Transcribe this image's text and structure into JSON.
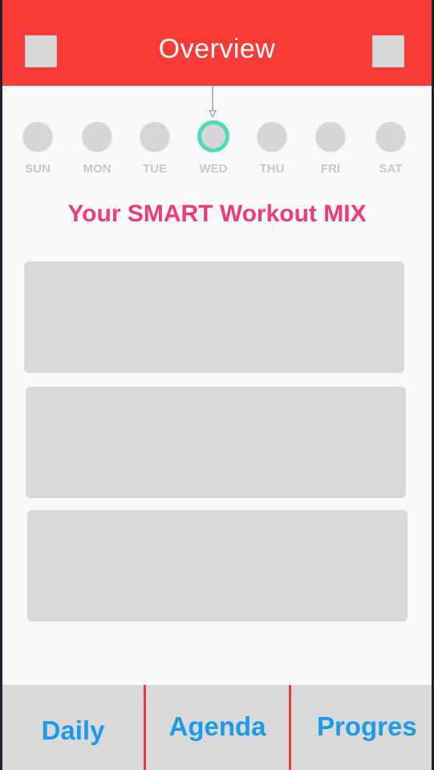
{
  "header": {
    "title": "Overview",
    "color": "#f93b37"
  },
  "week": {
    "days": [
      "SUN",
      "MON",
      "TUE",
      "WED",
      "THU",
      "FRI",
      "SAT"
    ],
    "selected": "WED",
    "selected_color": "#4ddbb8"
  },
  "section": {
    "title": "Your SMART Workout MIX",
    "color": "#ef3a7b"
  },
  "cards": [
    "",
    "",
    ""
  ],
  "tabs": {
    "daily": "Daily",
    "agenda": "Agenda",
    "progress": "Progres",
    "label_color": "#1c9bea",
    "divider_color": "#f0393a"
  }
}
